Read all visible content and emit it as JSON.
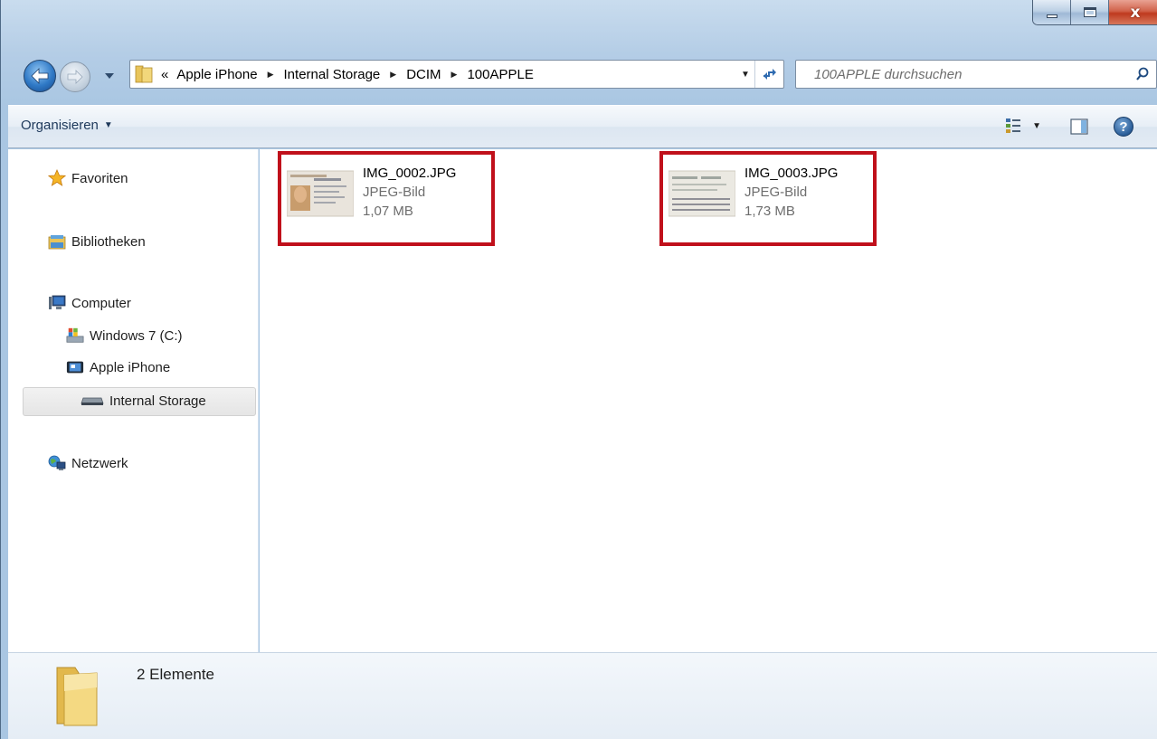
{
  "window": {
    "caption_buttons": {
      "close_glyph": "x"
    }
  },
  "navigation": {
    "breadcrumb_overflow": "«",
    "breadcrumbs": [
      "Apple iPhone",
      "Internal Storage",
      "DCIM",
      "100APPLE"
    ],
    "search_placeholder": "100APPLE durchsuchen"
  },
  "toolbar": {
    "organize_label": "Organisieren"
  },
  "sidebar": {
    "favorites": "Favoriten",
    "libraries": "Bibliotheken",
    "computer": "Computer",
    "drive_c": "Windows 7 (C:)",
    "iphone": "Apple iPhone",
    "internal_storage": "Internal Storage",
    "network": "Netzwerk"
  },
  "files": [
    {
      "name": "IMG_0002.JPG",
      "type": "JPEG-Bild",
      "size": "1,07 MB",
      "thumbnail": "id-card-front-photo"
    },
    {
      "name": "IMG_0003.JPG",
      "type": "JPEG-Bild",
      "size": "1,73 MB",
      "thumbnail": "id-card-back-text"
    }
  ],
  "status": {
    "item_count": "2 Elemente"
  },
  "colors": {
    "highlight_border": "#c0101b",
    "window_frame": "#b4cde6",
    "selection_bg": "#e5e5e5"
  },
  "icons": [
    "back-arrow-icon",
    "forward-arrow-icon",
    "history-dropdown-icon",
    "folder-icon",
    "refresh-icon",
    "search-icon",
    "view-options-icon",
    "preview-pane-icon",
    "help-icon",
    "star-icon",
    "library-icon",
    "computer-icon",
    "drive-icon",
    "iphone-icon",
    "storage-icon",
    "network-icon"
  ]
}
